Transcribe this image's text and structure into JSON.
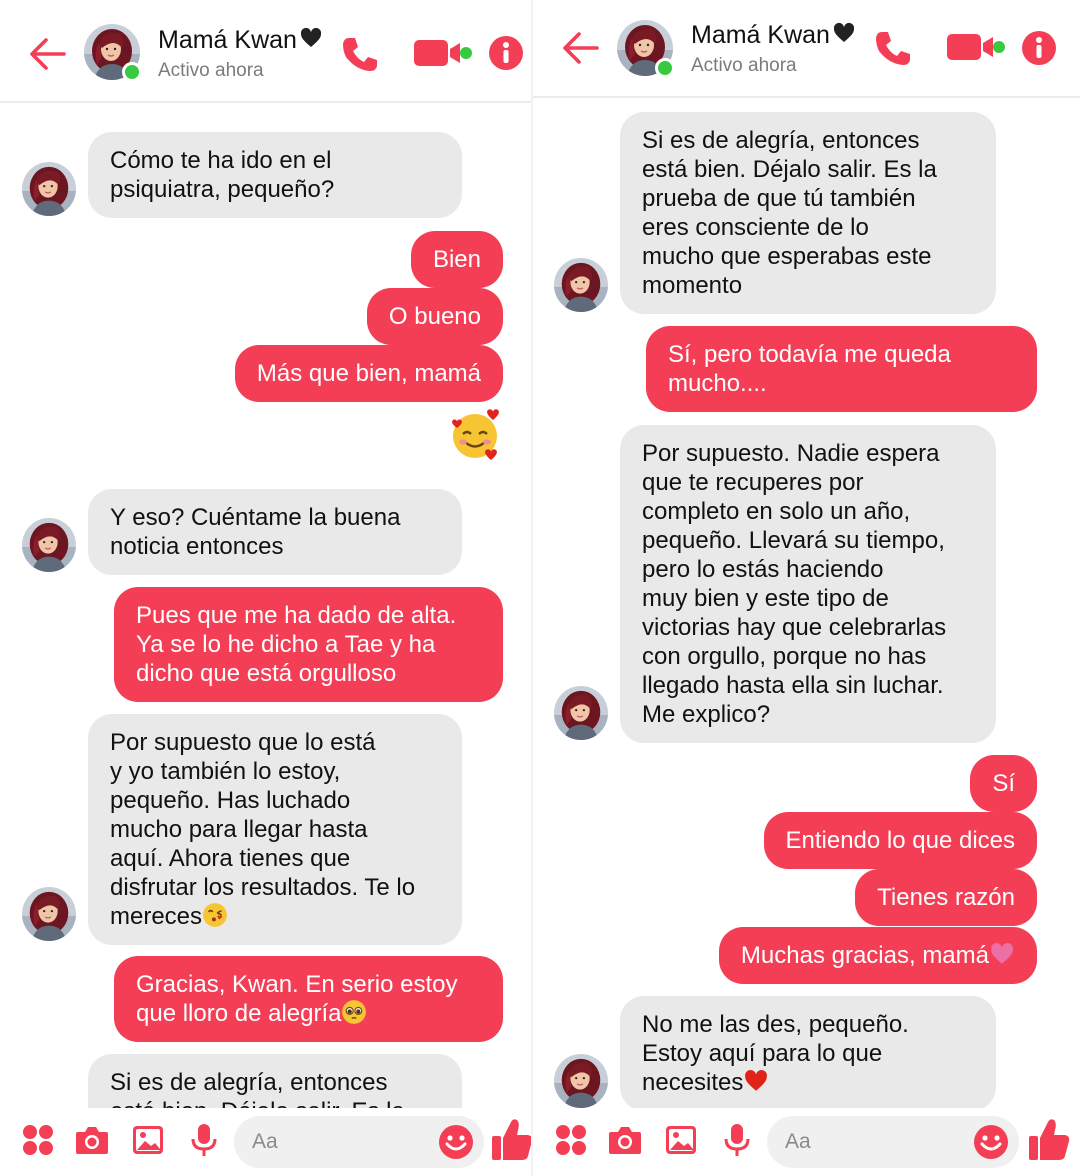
{
  "colors": {
    "accent": "#f33e55",
    "incoming_bubble": "#e9e9e9",
    "online": "#37c940"
  },
  "header": {
    "contact_name": "Mamá Kwan",
    "name_suffix_icon": "black-heart-icon",
    "status": "Activo ahora",
    "icons": [
      "back-arrow-icon",
      "phone-icon",
      "video-camera-icon",
      "info-icon"
    ]
  },
  "left": {
    "messages": [
      {
        "from": "contact",
        "text": "Cómo te ha ido en el\npsiquiatra, pequeño?"
      },
      {
        "from": "me",
        "text": "Bien"
      },
      {
        "from": "me",
        "text": "O bueno"
      },
      {
        "from": "me",
        "text": "Más que bien, mamá"
      },
      {
        "from": "me",
        "emoji": "smiling-face-with-hearts-icon"
      },
      {
        "from": "contact",
        "text": "Y eso? Cuéntame la buena\nnoticia entonces"
      },
      {
        "from": "me",
        "text": "Pues que me ha dado de alta.\nYa se lo he dicho a Tae y ha\ndicho que está orgulloso"
      },
      {
        "from": "contact",
        "text": "Por supuesto que lo está\ny yo también lo estoy,\npequeño. Has luchado\nmucho para llegar hasta\naquí. Ahora tienes que\ndisfrutar los resultados. Te lo\nmereces",
        "emoji": "face-blowing-kiss-icon"
      },
      {
        "from": "me",
        "text": "Gracias, Kwan. En serio estoy\nque lloro de alegría",
        "emoji": "pleading-face-icon"
      },
      {
        "from": "contact",
        "text": "Si es de alegría, entonces\nestá bien. Déjalo salir. Es la"
      }
    ]
  },
  "right": {
    "messages": [
      {
        "from": "contact",
        "text": "Si es de alegría, entonces\nestá bien. Déjalo salir. Es la\nprueba de que tú también\neres consciente de lo\nmucho que esperabas este\nmomento"
      },
      {
        "from": "me",
        "text": "Sí, pero todavía me queda\nmucho...."
      },
      {
        "from": "contact",
        "text": "Por supuesto. Nadie espera\nque te recuperes por\ncompleto en solo un año,\npequeño. Llevará su tiempo,\npero lo estás haciendo\nmuy bien y este tipo de\nvictorias hay que celebrarlas\ncon orgullo, porque no has\nllegado hasta ella sin luchar.\nMe explico?"
      },
      {
        "from": "me",
        "text": "Sí"
      },
      {
        "from": "me",
        "text": "Entiendo lo que dices"
      },
      {
        "from": "me",
        "text": "Tienes razón"
      },
      {
        "from": "me",
        "text": "Muchas gracias, mamá",
        "emoji": "pink-heart-icon"
      },
      {
        "from": "contact",
        "text": "No me las des, pequeño.\nEstoy aquí para lo que\nnecesites",
        "emoji": "red-heart-icon"
      }
    ]
  },
  "composer": {
    "placeholder": "Aa",
    "icons": [
      "menu-dots-icon",
      "camera-icon",
      "gallery-icon",
      "microphone-icon",
      "smiley-icon",
      "thumbs-up-icon"
    ]
  }
}
